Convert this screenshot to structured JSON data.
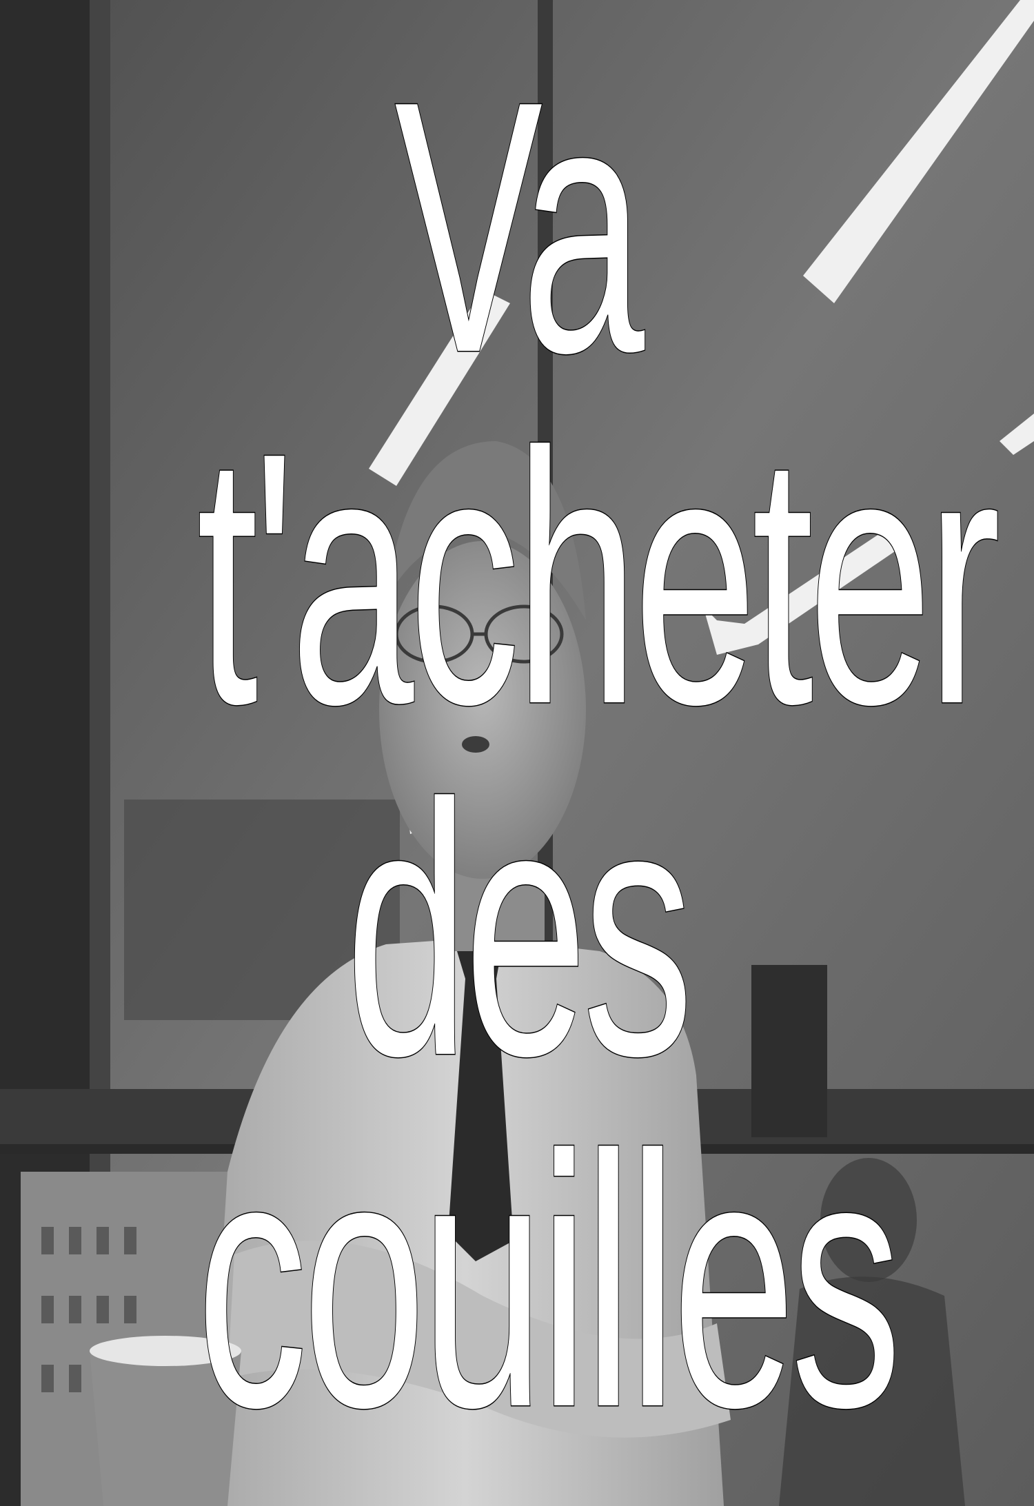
{
  "caption": {
    "line1": "Va",
    "line2": "t'acheter",
    "line3": "des",
    "line4": "couilles"
  },
  "photo": {
    "description_icon": "office-window-portrait-photo",
    "palette": [
      "#2a2a2a",
      "#5a5a5a",
      "#8a8a8a",
      "#d8d8d8",
      "#ffffff"
    ]
  }
}
